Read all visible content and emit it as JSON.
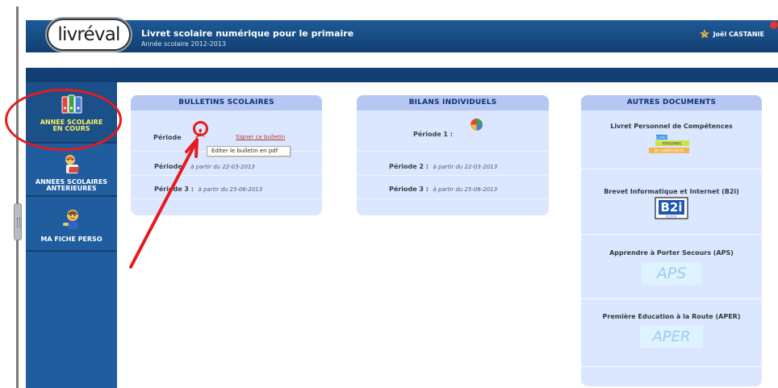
{
  "header": {
    "logo_text": "livréval",
    "title": "Livret scolaire numérique pour le primaire",
    "year": "Année scolaire 2012-2013",
    "user_name": "Joël CASTANIE"
  },
  "sidebar": {
    "items": [
      {
        "label_line1": "ANNEE SCOLAIRE",
        "label_line2": "EN COURS"
      },
      {
        "label_line1": "ANNEES SCOLAIRES",
        "label_line2": "ANTERIEURES"
      },
      {
        "label_line1": "MA FICHE PERSO",
        "label_line2": ""
      }
    ]
  },
  "bulletins": {
    "title": "BULLETINS SCOLAIRES",
    "period_1": "Période",
    "sign_link": "Signer ce bulletin",
    "tooltip": "Editer le bulletin en pdf",
    "period_2_label": "Période",
    "period_2_suffix": "à partir du 22-03-2013",
    "period_3_label": "Période 3 :",
    "period_3_suffix": "à partir du 25-06-2013"
  },
  "bilans": {
    "title": "BILANS INDIVIDUELS",
    "period_1": "Période 1 :",
    "period_2_label": "Période 2 :",
    "period_2_suffix": "à partir du 22-03-2013",
    "period_3_label": "Période 3 :",
    "period_3_suffix": "à partir du 25-06-2013"
  },
  "autres": {
    "title": "AUTRES DOCUMENTS",
    "documents": [
      {
        "title": "Livret Personnel de Compétences",
        "logo_text_top": "LIVRET",
        "logo_text_mid": "PERSONNEL",
        "logo_text_bottom": "DE COMPÉTENCES"
      },
      {
        "title": "Brevet Informatique et Internet (B2i)",
        "logo_text": "B2i",
        "logo_sub": "école"
      },
      {
        "title": "Apprendre à Porter Secours (APS)",
        "logo_text": "APS"
      },
      {
        "title": "Première Education à la Route (APER)",
        "logo_text": "APER"
      }
    ]
  },
  "colors": {
    "header_blue": "#1d5a96",
    "sidebar_blue": "#1f5d9f",
    "panel_bg": "#dbe7ff",
    "panel_head": "#b6c8f2",
    "annotation_red": "#e51b1f"
  }
}
